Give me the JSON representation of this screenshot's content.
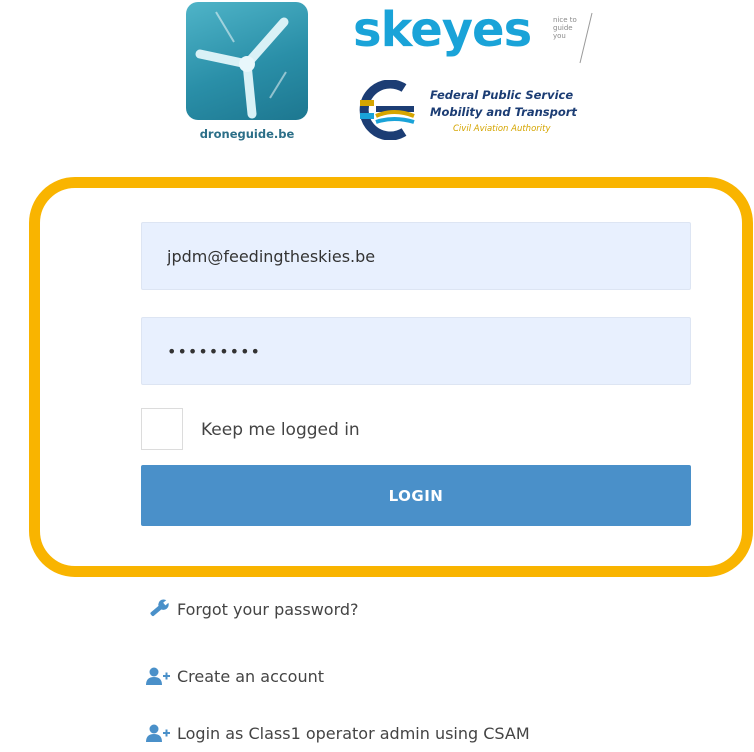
{
  "logos": {
    "droneguide": {
      "text": "droneguide.be",
      "tile_color": "#2a8fa8"
    },
    "skeyes": {
      "word": "skeyes",
      "tagline": [
        "nice to",
        "guide",
        "you"
      ],
      "color": "#1aa3d8"
    },
    "fps": {
      "line1": "Federal Public Service",
      "line2": "Mobility and Transport",
      "line3": "Civil Aviation Authority",
      "colors": {
        "navy": "#1c3d74",
        "yellow": "#d5a500"
      }
    }
  },
  "login": {
    "frame_color": "#f9b400",
    "email_value": "jpdm@feedingtheskies.be",
    "password_value": "•••••••••",
    "keep_logged_label": "Keep me logged in",
    "keep_logged_checked": false,
    "button_label": "LOGIN",
    "button_color": "#4a90c9",
    "field_bg": "#e8f0fe"
  },
  "links": {
    "forgot": {
      "label": "Forgot your password?",
      "icon": "wrench-icon"
    },
    "create": {
      "label": "Create an account",
      "icon": "add-user-icon"
    },
    "csam": {
      "label": "Login as Class1 operator admin using CSAM",
      "icon": "add-user-icon"
    }
  }
}
